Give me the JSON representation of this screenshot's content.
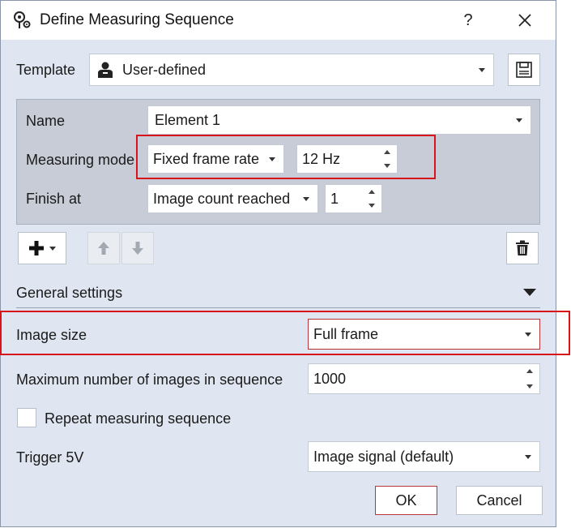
{
  "window": {
    "title": "Define Measuring Sequence",
    "help_label": "?"
  },
  "template": {
    "label": "Template",
    "value": "User-defined"
  },
  "element": {
    "name_label": "Name",
    "name_value": "Element 1",
    "measuring_mode_label": "Measuring mode",
    "measuring_mode_value": "Fixed frame rate",
    "frame_rate_value": "12 Hz",
    "finish_at_label": "Finish at",
    "finish_at_value": "Image count reached",
    "finish_count_value": "1"
  },
  "general_settings": {
    "header": "General settings",
    "image_size_label": "Image size",
    "image_size_value": "Full frame",
    "max_images_label": "Maximum number of images in sequence",
    "max_images_value": "1000",
    "repeat_label": "Repeat measuring sequence",
    "repeat_checked": false,
    "trigger_label": "Trigger 5V",
    "trigger_value": "Image signal (default)"
  },
  "buttons": {
    "ok": "OK",
    "cancel": "Cancel"
  },
  "colors": {
    "highlight": "#d7141a",
    "dialog_bg": "#dfe6f1",
    "panel_bg": "#c7ccd6"
  }
}
